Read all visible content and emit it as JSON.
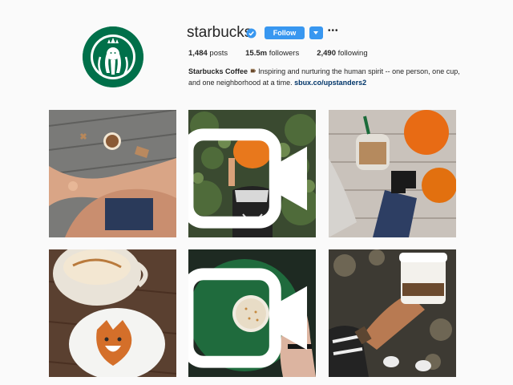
{
  "profile": {
    "username": "starbucks",
    "follow_label": "Follow",
    "more_label": "•••",
    "posts_count": "1,484",
    "posts_label": "posts",
    "followers_count": "15.5m",
    "followers_label": "followers",
    "following_count": "2,490",
    "following_label": "following",
    "bio_name": "Starbucks Coffee",
    "bio_text_1": "Inspiring and nurturing the human spirit -- one person, one",
    "bio_text_2": "cup, and one neighborhood at a time.",
    "bio_link": "sbux.co/upstanders2"
  },
  "colors": {
    "brand_green": "#00704a",
    "follow_blue": "#3897f0",
    "link_navy": "#003569"
  },
  "icons": [
    "verified-badge-icon",
    "chevron-down-icon",
    "more-options-icon",
    "coffee-cup-icon",
    "video-icon"
  ],
  "posts": [
    {
      "subject": "latte-and-crossed-legs"
    },
    {
      "subject": "pumpkin-face",
      "is_video": true
    },
    {
      "subject": "iced-drink-pumpkins"
    },
    {
      "subject": "whipped-drink-fox-cookie"
    },
    {
      "subject": "green-plate-drink",
      "is_video": true
    },
    {
      "subject": "hand-cup-shoes"
    }
  ]
}
